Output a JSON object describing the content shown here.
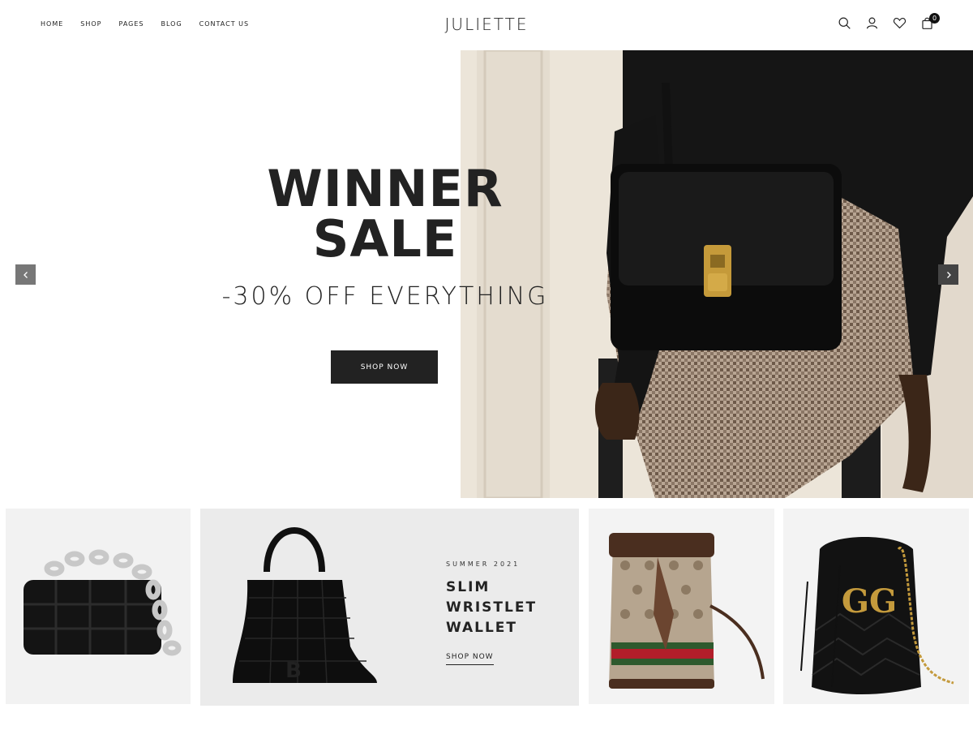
{
  "brand": {
    "logo": "JULIETTE"
  },
  "nav": {
    "items": [
      "HOME",
      "SHOP",
      "PAGES",
      "BLOG",
      "CONTACT US"
    ]
  },
  "header_icons": {
    "search": "search-icon",
    "account": "user-icon",
    "wishlist": "heart-icon",
    "cart": "bag-icon",
    "cart_count": "0"
  },
  "hero": {
    "title_line1": "WINNER",
    "title_line2": "SALE",
    "subtitle": "-30% OFF EVERYTHING",
    "button_label": "SHOP NOW",
    "prev_icon": "chevron-left-icon",
    "next_icon": "chevron-right-icon"
  },
  "promo": {
    "eyebrow": "SUMMER 2021",
    "title_line1": "SLIM WRISTLET",
    "title_line2": "WALLET",
    "link_label": "SHOP NOW"
  },
  "colors": {
    "accent": "#222222",
    "header_bg": "#ffffff",
    "tile_bg": "#ebebeb"
  }
}
